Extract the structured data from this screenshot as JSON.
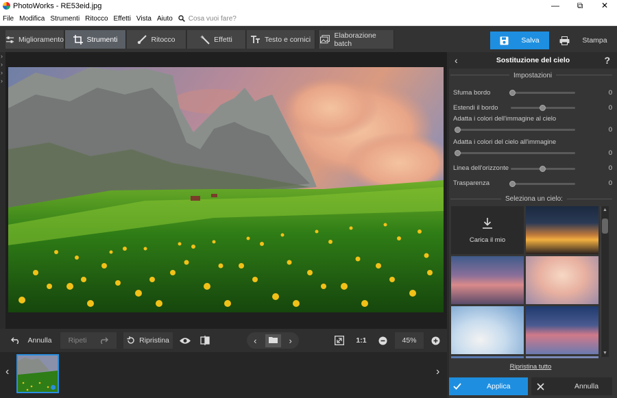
{
  "window": {
    "title": "PhotoWorks - RE53eid.jpg",
    "minimize": "—",
    "restore": "⧉",
    "close": "✕"
  },
  "menu": {
    "items": [
      "File",
      "Modifica",
      "Strumenti",
      "Ritocco",
      "Effetti",
      "Vista",
      "Aiuto"
    ],
    "search_placeholder": "Cosa vuoi fare?"
  },
  "tabs": [
    {
      "label": "Miglioramento",
      "icon": "sliders-icon"
    },
    {
      "label": "Strumenti",
      "icon": "crop-icon",
      "active": true
    },
    {
      "label": "Ritocco",
      "icon": "brush-icon"
    },
    {
      "label": "Effetti",
      "icon": "magic-wand-icon"
    },
    {
      "label": "Testo e cornici",
      "icon": "text-icon"
    },
    {
      "label": "Elaborazione batch",
      "icon": "batch-images-icon"
    }
  ],
  "actions": {
    "save": "Salva",
    "print": "Stampa"
  },
  "bottombar": {
    "undo": "Annulla",
    "redo": "Ripeti",
    "reset": "Ripristina",
    "ratio": "1:1",
    "zoom": "45%"
  },
  "panel": {
    "title": "Sostituzione del cielo",
    "help": "?",
    "settings_label": "Impostazioni",
    "sliders": [
      {
        "label": "Sfuma bordo",
        "value": "0",
        "level": 0
      },
      {
        "label": "Estendi il bordo",
        "value": "0",
        "level": 0.5
      },
      {
        "label": "Adatta i colori dell'immagine al cielo",
        "value": "0",
        "level": 0
      },
      {
        "label": "Adatta i colori del cielo all'immagine",
        "value": "0",
        "level": 0
      },
      {
        "label": "Linea dell'orizzonte",
        "value": "0",
        "level": 0.5
      },
      {
        "label": "Trasparenza",
        "value": "0",
        "level": 0
      }
    ],
    "select_sky_label": "Seleziona un cielo:",
    "load_own": "Carica il mio",
    "reset_all": "Ripristina tutto",
    "apply": "Applica",
    "cancel": "Annulla"
  },
  "colors": {
    "accent": "#1e8fe0",
    "background": "#2b2b2b",
    "panel": "#353535"
  }
}
